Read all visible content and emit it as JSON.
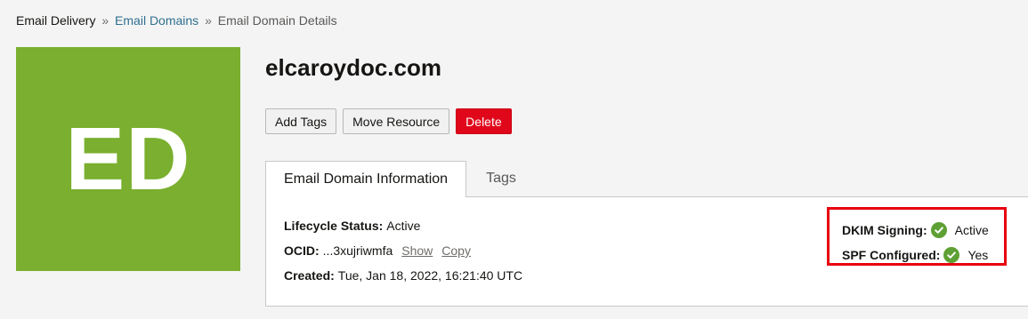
{
  "breadcrumb": {
    "root": "Email Delivery",
    "separator": "»",
    "parent": "Email Domains",
    "current": "Email Domain Details"
  },
  "avatar": {
    "initials": "ED",
    "color": "#7aaf2f"
  },
  "title": "elcaroydoc.com",
  "actions": {
    "add_tags": "Add Tags",
    "move_resource": "Move Resource",
    "delete": "Delete"
  },
  "tabs": [
    {
      "label": "Email Domain Information",
      "active": true
    },
    {
      "label": "Tags",
      "active": false
    }
  ],
  "info": {
    "lifecycle_label": "Lifecycle Status:",
    "lifecycle_value": "Active",
    "ocid_label": "OCID:",
    "ocid_value": "...3xujriwmfa",
    "show_link": "Show",
    "copy_link": "Copy",
    "created_label": "Created:",
    "created_value": "Tue, Jan 18, 2022, 16:21:40 UTC"
  },
  "status": {
    "dkim_label": "DKIM Signing:",
    "dkim_value": "Active",
    "dkim_icon": "check-circle-icon",
    "spf_label": "SPF Configured:",
    "spf_value": "Yes",
    "spf_icon": "check-circle-icon",
    "highlight_color": "#e8000f",
    "check_color": "#5ea034"
  }
}
